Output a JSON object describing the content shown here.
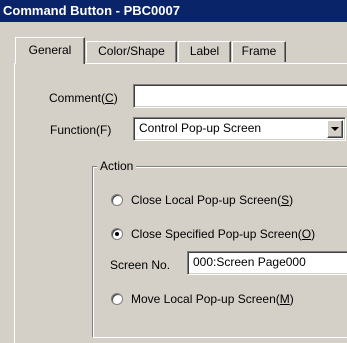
{
  "window": {
    "title": "Command Button - PBC0007"
  },
  "tabs": [
    {
      "label": "General",
      "active": true
    },
    {
      "label": "Color/Shape",
      "active": false
    },
    {
      "label": "Label",
      "active": false
    },
    {
      "label": "Frame",
      "active": false
    }
  ],
  "general": {
    "comment": {
      "label": "Comment(",
      "hotkey": "C",
      "label_end": ")",
      "value": ""
    },
    "function": {
      "label": "Function(F)",
      "value": "Control Pop-up Screen"
    },
    "action": {
      "legend": "Action",
      "options": [
        {
          "label": "Close Local Pop-up Screen(",
          "hotkey": "S",
          "label_end": ")",
          "checked": false
        },
        {
          "label": "Close Specified Pop-up Screen(",
          "hotkey": "O",
          "label_end": ")",
          "checked": true
        },
        {
          "label": "Move Local Pop-up Screen(",
          "hotkey": "M",
          "label_end": ")",
          "checked": false
        }
      ],
      "screen_no": {
        "label": "Screen No.",
        "value": "000:Screen Page000"
      }
    }
  }
}
